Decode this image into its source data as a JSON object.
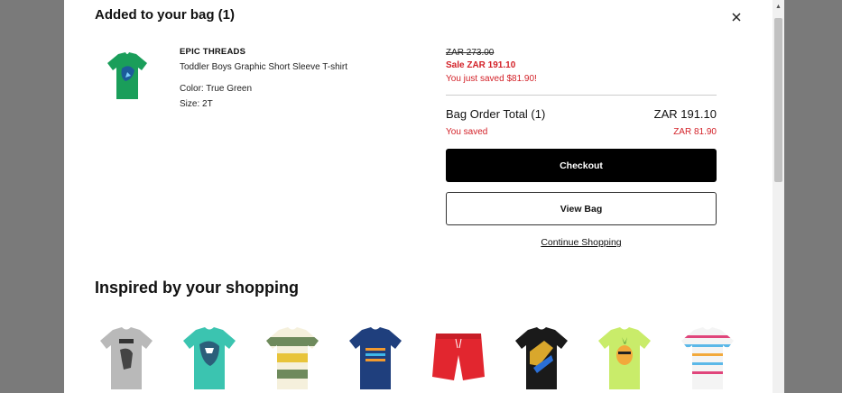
{
  "modal": {
    "title": "Added to your bag (1)",
    "close_icon": "close-icon"
  },
  "product": {
    "brand": "EPIC THREADS",
    "name": "Toddler Boys Graphic Short Sleeve T-shirt",
    "color": "Color: True Green",
    "size": "Size: 2T",
    "image_icon": "green-tshirt-image",
    "shirt_color": "#1a9e5a"
  },
  "pricing": {
    "original": "ZAR 273.00",
    "sale": "Sale ZAR 191.10",
    "saved_note": "You just saved $81.90!",
    "sale_color": "#d32128"
  },
  "summary": {
    "total_label": "Bag Order Total (1)",
    "total_value": "ZAR 191.10",
    "saved_label": "You saved",
    "saved_value": "ZAR 81.90"
  },
  "actions": {
    "checkout": "Checkout",
    "view_bag": "View Bag",
    "continue": "Continue Shopping"
  },
  "recommendations": {
    "title": "Inspired by your shopping",
    "items": [
      {
        "icon": "gray-dino-tshirt-image",
        "color": "#b9b9b9"
      },
      {
        "icon": "teal-dino-tshirt-image",
        "color": "#3bc4b0"
      },
      {
        "icon": "striped-tshirt-image",
        "color": "#e9e2c8"
      },
      {
        "icon": "navy-tshirt-image",
        "color": "#1f3f7d"
      },
      {
        "icon": "red-shorts-image",
        "color": "#e2262f"
      },
      {
        "icon": "black-graphic-tshirt-image",
        "color": "#1a1a1a"
      },
      {
        "icon": "lime-pineapple-tshirt-image",
        "color": "#c9ec6a"
      },
      {
        "icon": "white-striped-tshirt-image",
        "color": "#f4f4f4"
      }
    ]
  }
}
